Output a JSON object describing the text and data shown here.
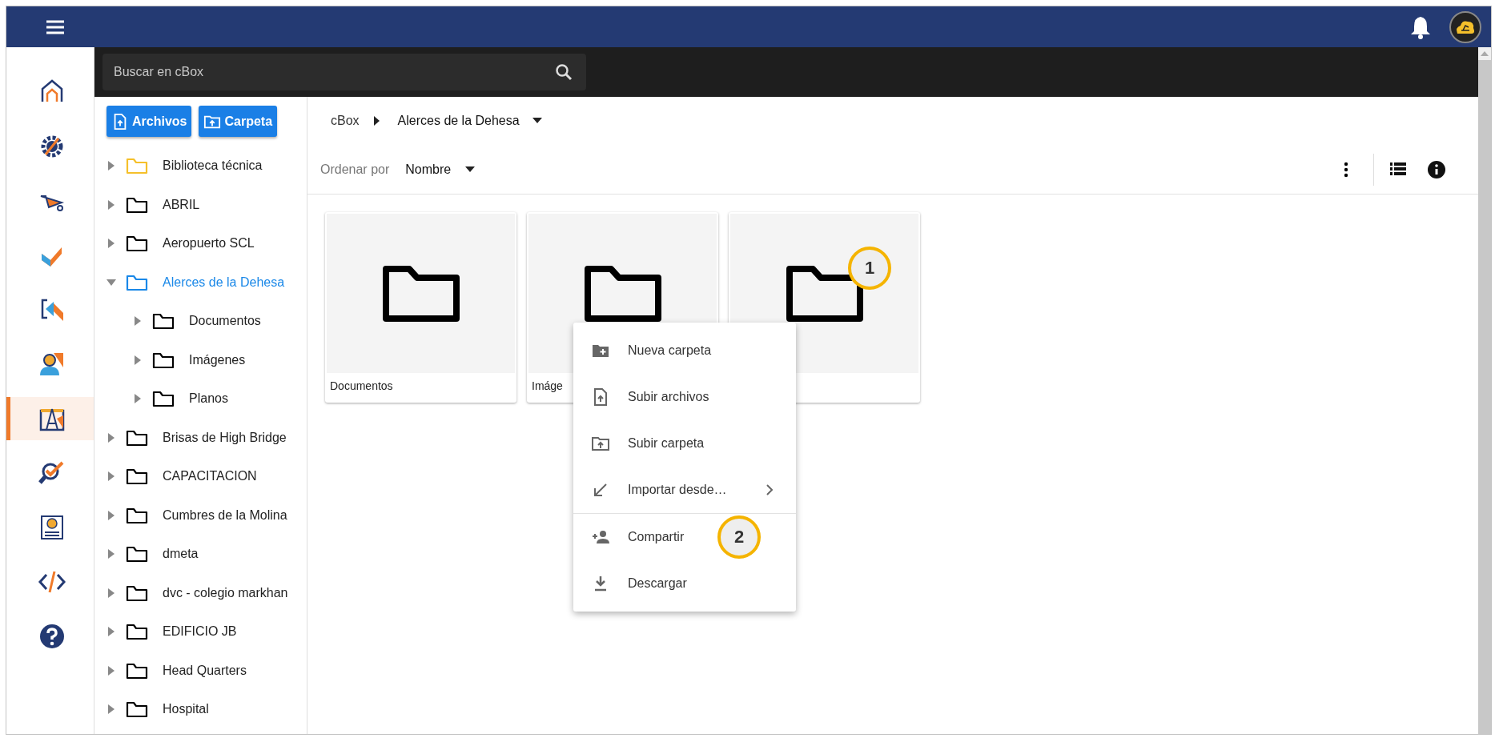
{
  "search": {
    "placeholder": "Buscar en cBox"
  },
  "rail": [
    {
      "kind": "home",
      "selected": false
    },
    {
      "kind": "gear",
      "selected": false
    },
    {
      "kind": "wheelbarrow",
      "selected": false
    },
    {
      "kind": "check",
      "selected": false
    },
    {
      "kind": "arrows",
      "selected": false
    },
    {
      "kind": "person",
      "selected": false
    },
    {
      "kind": "drafting",
      "selected": true
    },
    {
      "kind": "inspect",
      "selected": false
    },
    {
      "kind": "money",
      "selected": false
    },
    {
      "kind": "code",
      "selected": false
    },
    {
      "kind": "help",
      "selected": false
    }
  ],
  "upload_buttons": [
    {
      "kind": "file",
      "label": "Archivos"
    },
    {
      "kind": "folder",
      "label": "Carpeta"
    }
  ],
  "tree": [
    {
      "label": "Biblioteca técnica",
      "expanded": false,
      "selected": false,
      "color": "#f5c02b"
    },
    {
      "label": "ABRIL",
      "expanded": false,
      "selected": false,
      "color": "#000000"
    },
    {
      "label": "Aeropuerto SCL",
      "expanded": false,
      "selected": false,
      "color": "#000000"
    },
    {
      "label": "Alerces de la Dehesa",
      "expanded": true,
      "selected": true,
      "color": "#1a88e8",
      "children": [
        {
          "label": "Documentos",
          "expanded": false,
          "selected": false,
          "color": "#000000"
        },
        {
          "label": "Imágenes",
          "expanded": false,
          "selected": false,
          "color": "#000000"
        },
        {
          "label": "Planos",
          "expanded": false,
          "selected": false,
          "color": "#000000"
        }
      ]
    },
    {
      "label": "Brisas de High Bridge",
      "expanded": false,
      "selected": false,
      "color": "#000000"
    },
    {
      "label": "CAPACITACION",
      "expanded": false,
      "selected": false,
      "color": "#000000"
    },
    {
      "label": "Cumbres de la Molina",
      "expanded": false,
      "selected": false,
      "color": "#000000"
    },
    {
      "label": "dmeta",
      "expanded": false,
      "selected": false,
      "color": "#000000"
    },
    {
      "label": "dvc - colegio markhan",
      "expanded": false,
      "selected": false,
      "color": "#000000"
    },
    {
      "label": "EDIFICIO JB",
      "expanded": false,
      "selected": false,
      "color": "#000000"
    },
    {
      "label": "Head Quarters",
      "expanded": false,
      "selected": false,
      "color": "#000000"
    },
    {
      "label": "Hospital",
      "expanded": false,
      "selected": false,
      "color": "#000000"
    }
  ],
  "breadcrumb": {
    "root": "cBox",
    "current": "Alerces de la Dehesa"
  },
  "sort": {
    "label": "Ordenar por",
    "value": "Nombre"
  },
  "cards": [
    {
      "label": "Documentos"
    },
    {
      "label": "Imáge"
    },
    {
      "annotation": "1"
    }
  ],
  "context_menu": {
    "items": [
      {
        "kind": "new-folder",
        "label": "Nueva carpeta",
        "divider_before": false,
        "submenu": false
      },
      {
        "kind": "upload-file",
        "label": "Subir archivos",
        "divider_before": false,
        "submenu": false
      },
      {
        "kind": "upload-folder",
        "label": "Subir carpeta",
        "divider_before": false,
        "submenu": false
      },
      {
        "kind": "import",
        "label": "Importar desde…",
        "divider_before": false,
        "submenu": true
      },
      {
        "kind": "share",
        "label": "Compartir",
        "divider_before": true,
        "submenu": false,
        "annotation": "2"
      },
      {
        "kind": "download",
        "label": "Descargar",
        "divider_before": false,
        "submenu": false
      }
    ]
  }
}
